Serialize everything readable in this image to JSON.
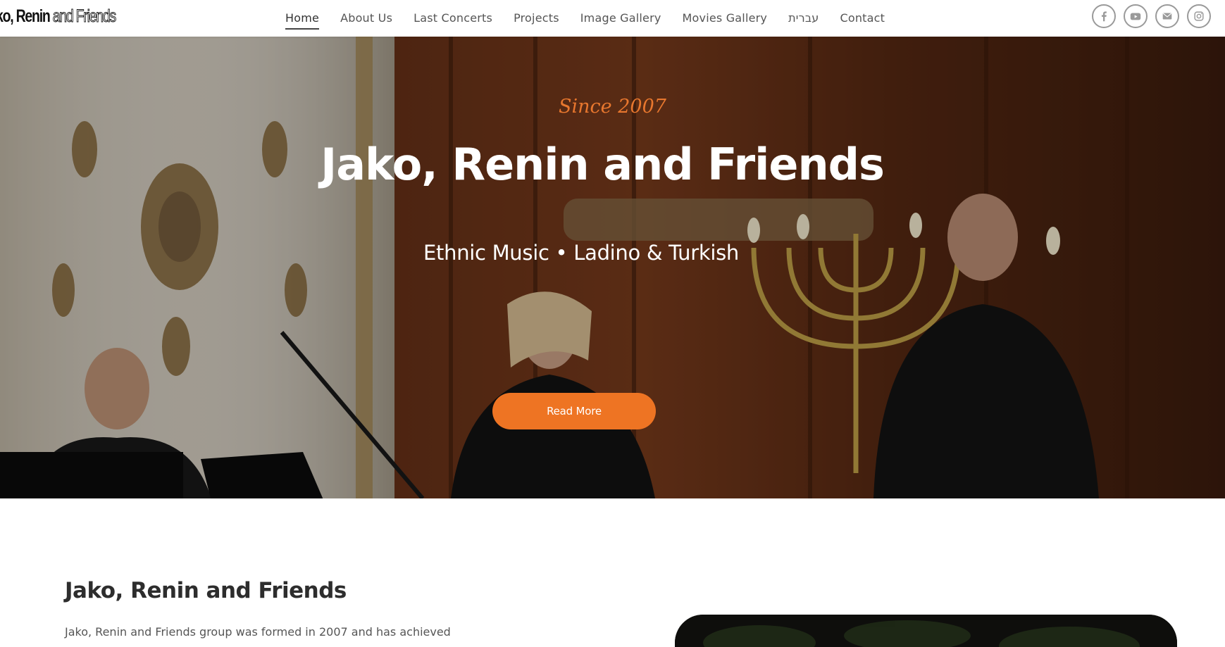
{
  "header": {
    "logo": {
      "part1": "ko, Renin ",
      "part2": "and Friends"
    },
    "nav": [
      {
        "label": "Home",
        "active": true
      },
      {
        "label": "About Us",
        "active": false
      },
      {
        "label": "Last Concerts",
        "active": false
      },
      {
        "label": "Projects",
        "active": false
      },
      {
        "label": "Image Gallery",
        "active": false
      },
      {
        "label": "Movies Gallery",
        "active": false
      },
      {
        "label": "עברית",
        "active": false
      },
      {
        "label": "Contact",
        "active": false
      }
    ],
    "social": [
      "facebook-icon",
      "youtube-icon",
      "email-icon",
      "instagram-icon"
    ]
  },
  "hero": {
    "since": "Since 2007",
    "title": "Jako, Renin and Friends",
    "subtitle": "Ethnic Music • Ladino & Turkish",
    "button": "Read More"
  },
  "about": {
    "title": "Jako, Renin and Friends",
    "text": "Jako, Renin and Friends group was formed in 2007 and has achieved"
  },
  "colors": {
    "accent": "#ee7423",
    "since_text": "#e8772e",
    "nav_text": "#555555"
  }
}
